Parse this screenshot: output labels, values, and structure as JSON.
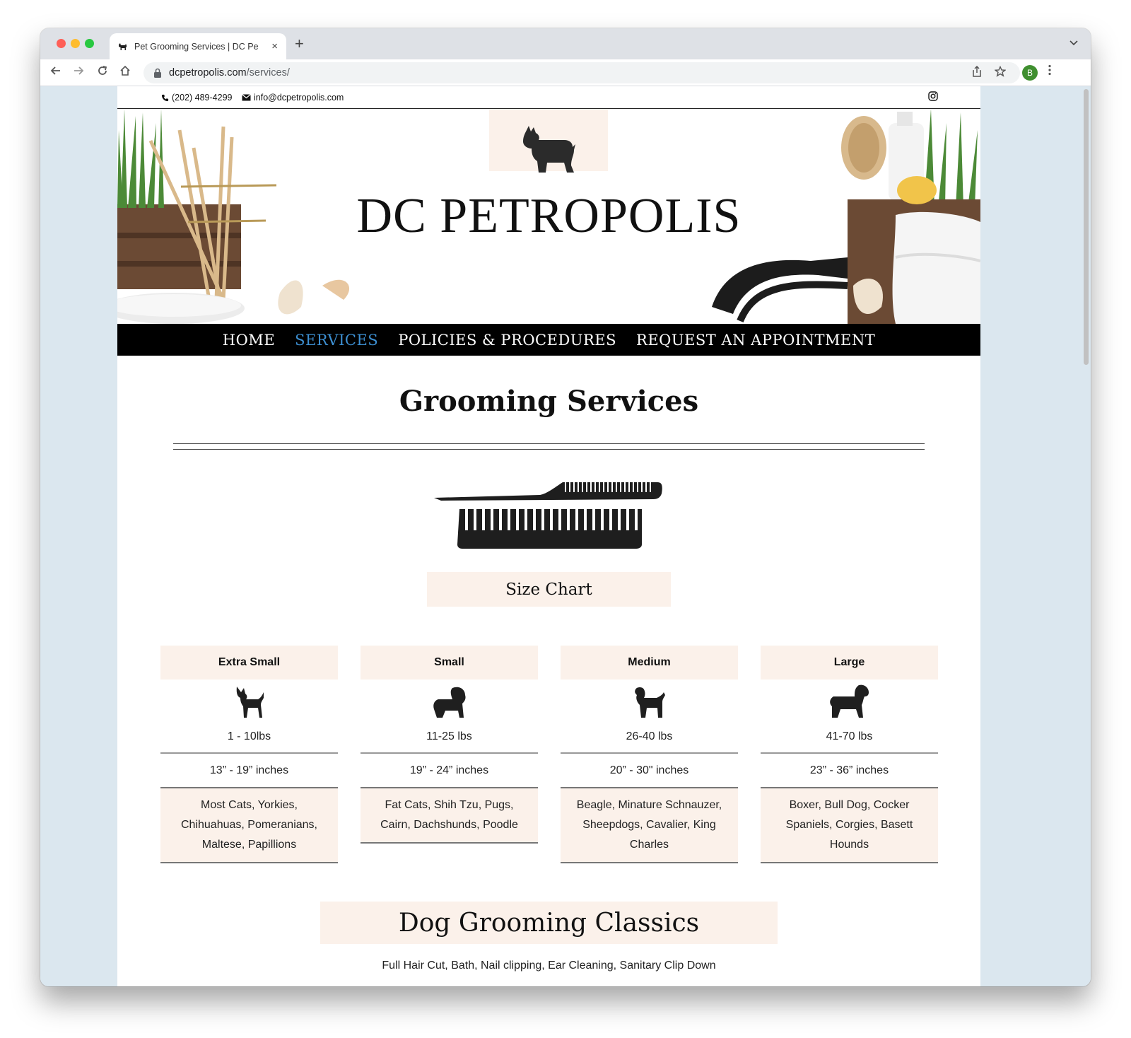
{
  "browser": {
    "tab_title": "Pet Grooming Services | DC Pe",
    "new_tab": "+",
    "tab_close": "×",
    "url_domain": "dcpetropolis.com",
    "url_path": "/services/",
    "profile_initial": "B"
  },
  "topbar": {
    "phone": "(202) 489-4299",
    "email": "info@dcpetropolis.com"
  },
  "brand": "DC PETROPOLIS",
  "nav": {
    "home": "HOME",
    "services": "SERVICES",
    "policies": "POLICIES & PROCEDURES",
    "appointment": "REQUEST AN APPOINTMENT"
  },
  "grooming": {
    "title": "Grooming Services",
    "size_chart": "Size Chart"
  },
  "sizes": [
    {
      "name": "Extra Small",
      "weight": "1 - 10lbs",
      "height": "13” - 19” inches",
      "breeds": "Most Cats, Yorkies, Chihuahuas, Pomeranians, Maltese, Papillions"
    },
    {
      "name": "Small",
      "weight": "11-25 lbs",
      "height": "19” - 24” inches",
      "breeds": "Fat Cats, Shih Tzu, Pugs, Cairn, Dachshunds, Poodle"
    },
    {
      "name": "Medium",
      "weight": "26-40 lbs",
      "height": "20” - 30\" inches",
      "breeds": "Beagle, Minature Schnauzer, Sheepdogs, Cavalier, King Charles"
    },
    {
      "name": "Large",
      "weight": "41-70 lbs",
      "height": "23” - 36” inches",
      "breeds": "Boxer, Bull Dog, Cocker Spaniels, Corgies, Basett Hounds"
    }
  ],
  "classics": {
    "title": "Dog Grooming Classics",
    "description": "Full Hair Cut, Bath, Nail clipping, Ear Cleaning, Sanitary Clip Down"
  },
  "colors": {
    "accent": "#3d8fd1",
    "cream": "#fbf1ea",
    "nav_bg": "#000000"
  }
}
